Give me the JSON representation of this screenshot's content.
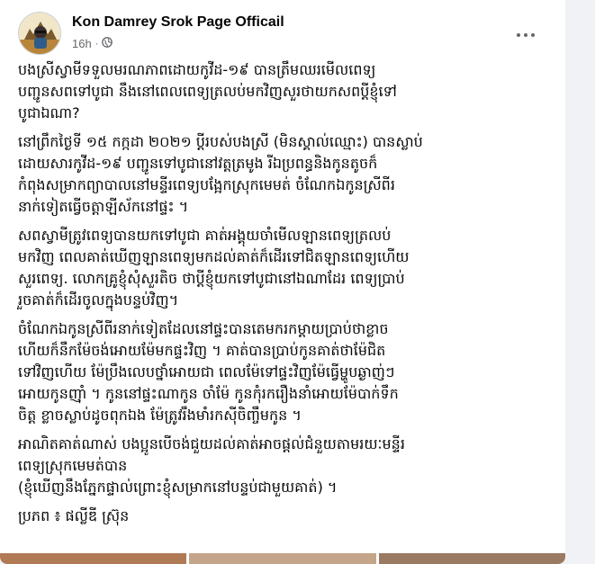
{
  "post": {
    "page_name": "Kon Damrey Srok Page Officail",
    "time": "16h",
    "visibility_icon": "globe-icon",
    "paragraphs": [
      "បងស្រីស្វាមីទទួលមរណភាពដោយកូវីដ-១៩ បានត្រឹមឈរមើលពេទ្យ\nបញ្ជូនសពទៅបូជា នឹងនៅពេលពេទ្យត្រលប់មកវិញសួរថាយកសពប្តីខ្ញុំទៅ\nបូជាឯណា?",
      "នៅព្រឹកថ្ងៃទី ១៥ កក្កដា ២០២១ ប្តីរបស់បងស្រី (មិនស្គាល់ឈ្មោះ) បានស្លាប់\nដោយសារកូវីដ-១៩ បញ្ជូនទៅបូជានៅវត្តត្រមូង រីឯប្រពន្ធនិងកូនតូចក៏\nកំពុងសម្រាកព្យាបាលនៅមន្ទីរពេទ្យបង្អែកស្រុកមេមត់ ចំណែកឯកូនស្រីពីរ\nនាក់ទៀតធ្វើចត្តាឡីស័កនៅផ្ទះ ។",
      "សពស្វាមីត្រូវពេទ្យបានយកទៅបូជា គាត់អង្គុយចាំមើលឡានពេទ្យត្រលប់\nមកវិញ ពេលគាត់ឃើញឡានពេទ្យមកដល់គាត់ក៏ដើរទៅជិតឡានពេទ្យហើយ\nសួរពេទ្យ. លោកគ្រូខ្ញុំសុំសួរតិច ថាប្តីខ្ញុំយកទៅបូជានៅឯណាដែរ ពេទ្យប្រាប់\nរួចគាត់ក៏ដើរចូលក្នុងបន្ទប់វិញ។",
      "ចំណែកឯកូនស្រីពីរនាក់ទៀតដែលនៅផ្ទះបានតេមករកម្តាយប្រាប់ថាខ្លាច\nហើយក៏នឹកម៉ែចង់អោយម៉ែមកផ្ទះវិញ ។ គាត់បានប្រាប់កូនគាត់ថាម៉ែជិត\nទៅវិញហើយ ម៉ែប្រឹងលេបថ្នាំអោយជា ពេលម៉ែទៅផ្ទះវិញម៉ែធ្វើម្ហូបឆ្ងាញ់ៗ\nអោយកូនញ៉ាំ ។ កូននៅផ្ទះណាកូន ចាំម៉ែ កូនកុំរករឿងនាំអោយម៉ែបាក់ទឹក\nចិត្ត ខ្លាចស្លាប់ដូចពុកឯង ម៉ែត្រូវរឹងមាំរកស៊ីចិញ្ចឹមកូន ។",
      "អាណិតគាត់ណាស់ បងប្អូនបើចង់ជួយដល់គាត់អាចផ្តល់ជំនួយតាមរយៈមន្ទីរ\nពេទ្យស្រុកមេមត់បាន\n(ខ្ញុំឃើញនឹងភ្នែកផ្ទាល់ព្រោះខ្ញុំសម្រាកនៅបន្ទប់ជាមួយគាត់) ។",
      "ប្រភព ៖ ផល្លីឌី ស្រ៊ុន"
    ]
  },
  "colors": {
    "page_bg": "#f0f2f5",
    "card_bg": "#ffffff",
    "meta_text": "#65676b"
  }
}
